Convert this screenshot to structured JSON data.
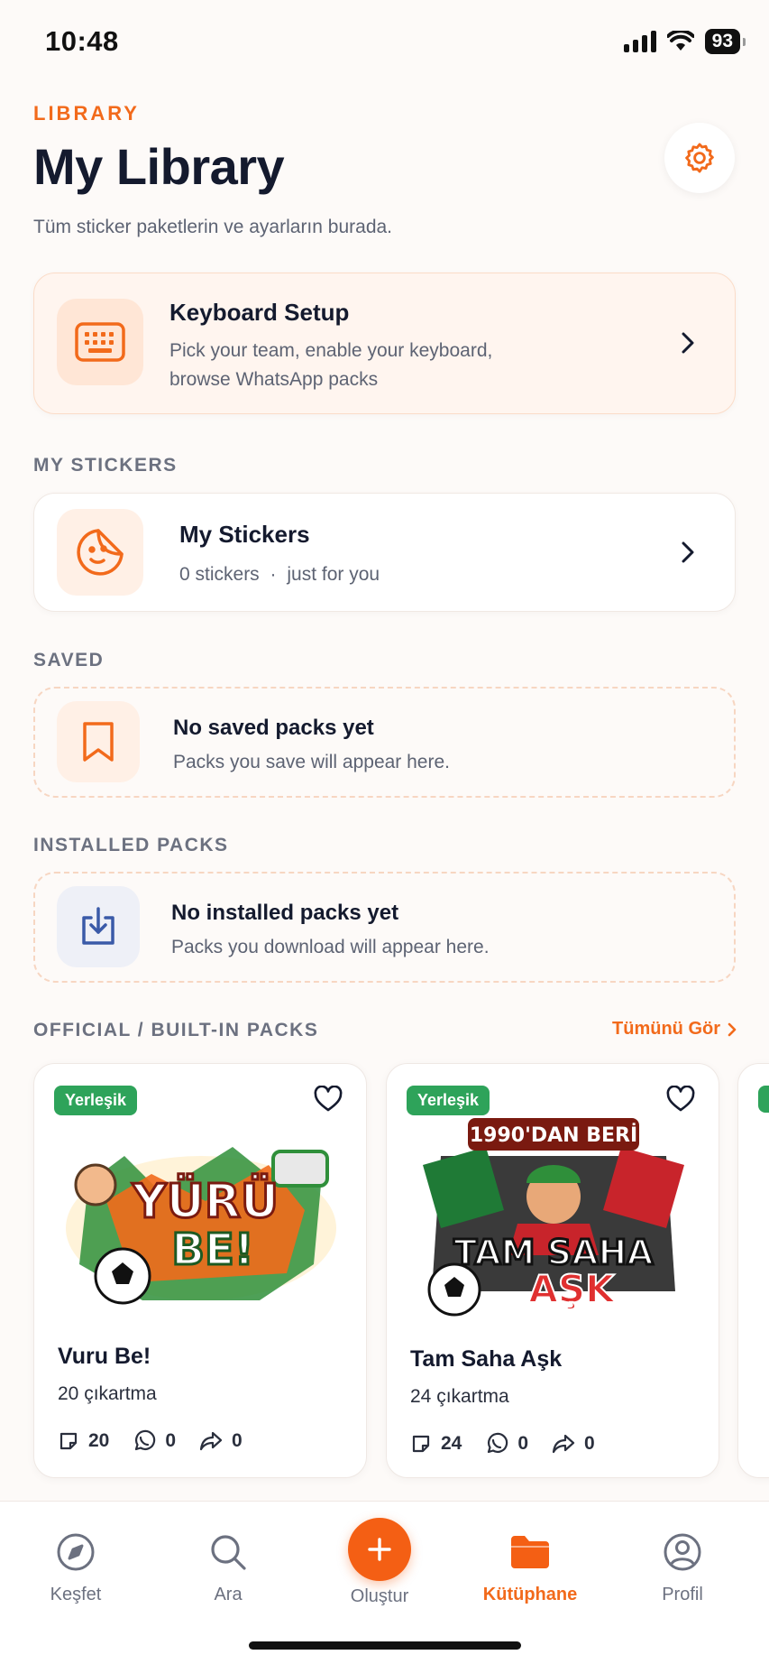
{
  "status_bar": {
    "time": "10:48",
    "battery": "93"
  },
  "header": {
    "eyebrow": "LIBRARY",
    "title": "My Library",
    "subtitle": "Tüm sticker paketlerin ve ayarların burada."
  },
  "keyboard_setup": {
    "title": "Keyboard Setup",
    "desc_line1": "Pick your team, enable your keyboard,",
    "desc_line2": "browse WhatsApp packs"
  },
  "sections": {
    "my_stickers": "MY STICKERS",
    "saved": "SAVED",
    "installed": "INSTALLED PACKS",
    "official": "OFFICIAL / BUILT-IN PACKS",
    "see_all": "Tümünü Gör"
  },
  "my_stickers_card": {
    "title": "My Stickers",
    "count": "0 stickers",
    "separator": "·",
    "tagline": "just for you"
  },
  "saved_card": {
    "title": "No saved packs yet",
    "desc": "Packs you save will appear here."
  },
  "installed_card": {
    "title": "No installed packs yet",
    "desc": "Packs you download will appear here."
  },
  "packs": [
    {
      "badge": "Yerleşik",
      "name": "Vuru Be!",
      "count_label": "20 çıkartma",
      "stickers": "20",
      "whatsapp": "0",
      "shares": "0",
      "art_line1": "YÜRÜ",
      "art_line2": "BE!"
    },
    {
      "badge": "Yerleşik",
      "name": "Tam Saha Aşk",
      "count_label": "24 çıkartma",
      "stickers": "24",
      "whatsapp": "0",
      "shares": "0",
      "art_top": "1990'DAN BERİ",
      "art_line1": "TAM SAHA",
      "art_line2": "AŞK"
    }
  ],
  "tabbar": {
    "explore": "Keşfet",
    "search": "Ara",
    "create": "Oluştur",
    "library": "Kütüphane",
    "profile": "Profil"
  },
  "colors": {
    "accent": "#f26a1b",
    "badge_green": "#2ea35a",
    "title": "#141a2e"
  }
}
